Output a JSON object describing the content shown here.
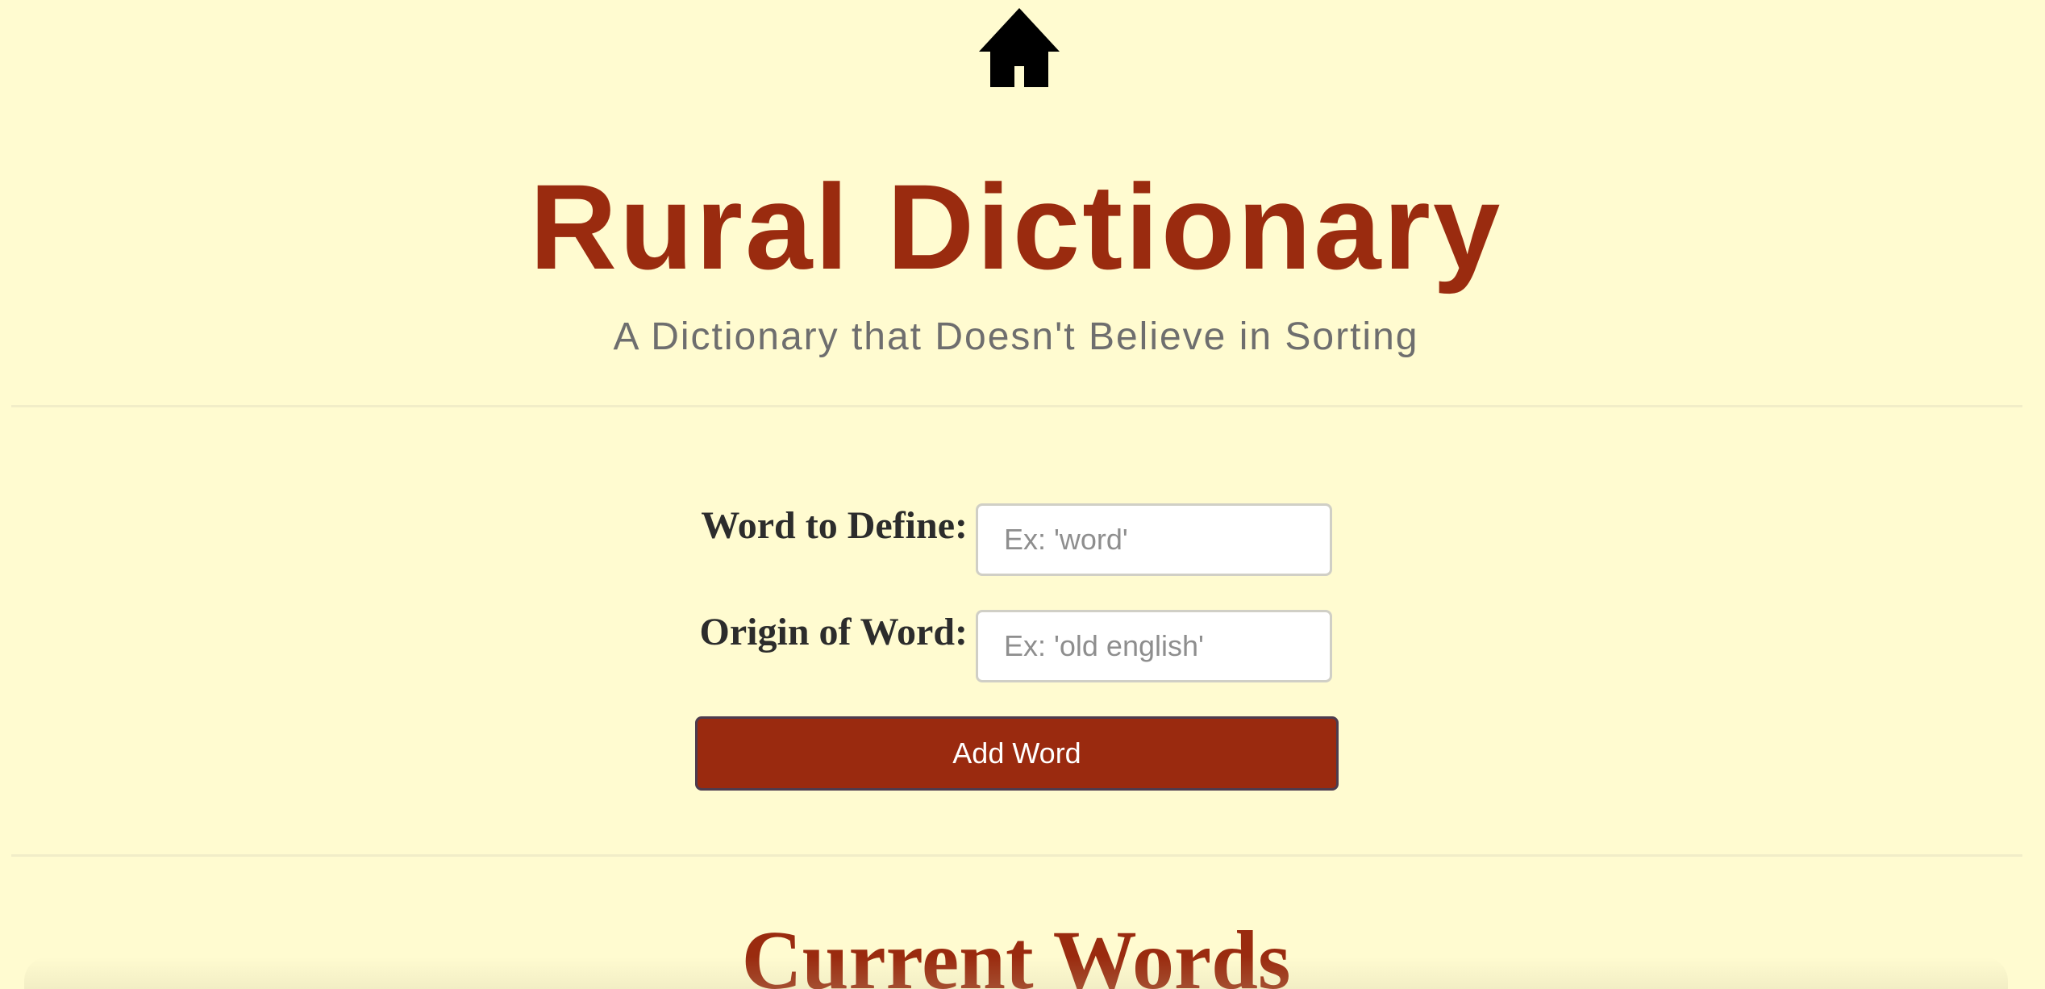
{
  "header": {
    "home_icon": "home-icon",
    "title": "Rural Dictionary",
    "subtitle": "A Dictionary that Doesn't Believe in Sorting"
  },
  "form": {
    "word_label": "Word to Define:",
    "word_placeholder": "Ex: 'word'",
    "word_value": "",
    "origin_label": "Origin of Word:",
    "origin_placeholder": "Ex: 'old english'",
    "origin_value": "",
    "submit_label": "Add Word"
  },
  "words_section": {
    "title": "Current Words"
  },
  "colors": {
    "background": "#FFFBD0",
    "accent": "#9A2B0F",
    "subtitle": "#6E6E6E"
  }
}
